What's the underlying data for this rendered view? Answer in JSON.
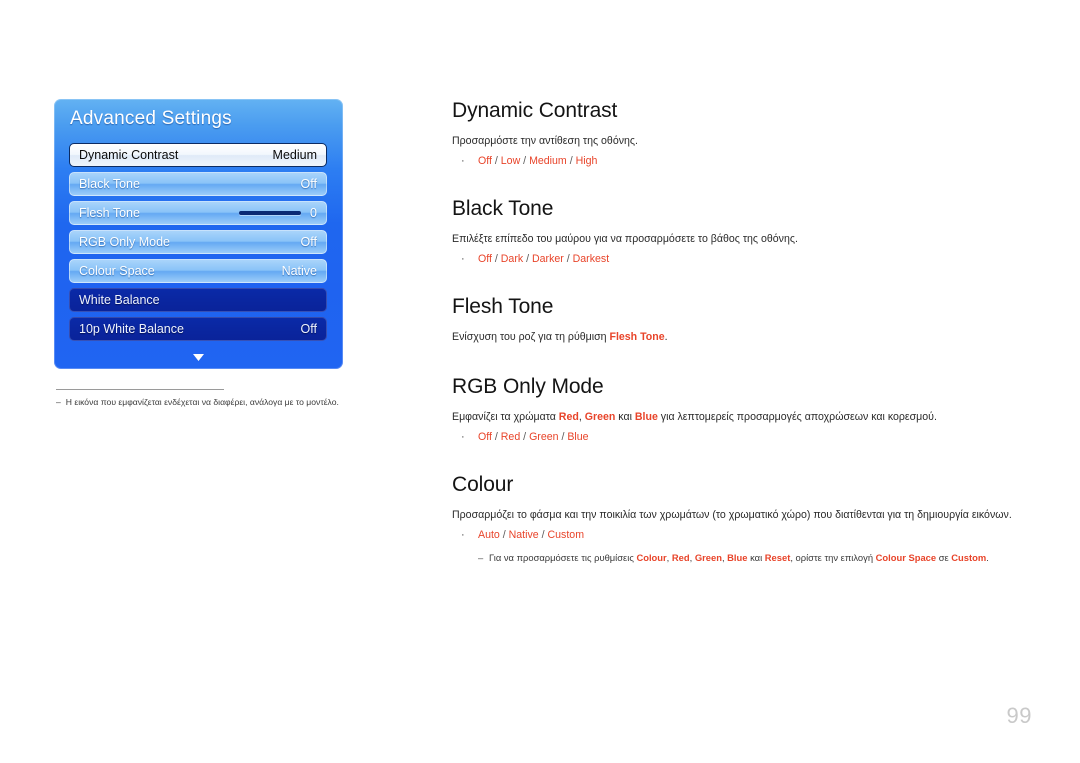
{
  "osd": {
    "title": "Advanced Settings",
    "scroll_arrow_icon": "chevron-down-icon",
    "rows": [
      {
        "label": "Dynamic Contrast",
        "value": "Medium",
        "style": "selected"
      },
      {
        "label": "Black Tone",
        "value": "Off",
        "style": "light"
      },
      {
        "label": "Flesh Tone",
        "value": "0",
        "style": "light",
        "slider": true
      },
      {
        "label": "RGB Only Mode",
        "value": "Off",
        "style": "light"
      },
      {
        "label": "Colour Space",
        "value": "Native",
        "style": "light"
      },
      {
        "label": "White Balance",
        "value": "",
        "style": "dark"
      },
      {
        "label": "10p White Balance",
        "value": "Off",
        "style": "dark"
      }
    ]
  },
  "figure_note": {
    "dash": "–",
    "text": "Η εικόνα που εμφανίζεται ενδέχεται να διαφέρει, ανάλογα με το μοντέλο."
  },
  "sections": {
    "dynamic_contrast": {
      "heading": "Dynamic Contrast",
      "body": "Προσαρμόστε την αντίθεση της οθόνης.",
      "bullet": "·",
      "options_1": "Off",
      "options_2": "Low",
      "options_3": "Medium",
      "options_4": "High"
    },
    "black_tone": {
      "heading": "Black Tone",
      "body": "Επιλέξτε επίπεδο του μαύρου για να προσαρμόσετε το βάθος της οθόνης.",
      "bullet": "·",
      "options_1": "Off",
      "options_2": "Dark",
      "options_3": "Darker",
      "options_4": "Darkest"
    },
    "flesh_tone": {
      "heading": "Flesh Tone",
      "body_pre": "Ενίσχυση του ροζ για τη ρύθμιση ",
      "body_accent": "Flesh Tone",
      "body_post": "."
    },
    "rgb_only_mode": {
      "heading": "RGB Only Mode",
      "body_pre": "Εμφανίζει τα χρώματα ",
      "body_red": "Red",
      "body_comma": ", ",
      "body_green": "Green",
      "body_mid": " και ",
      "body_blue": "Blue",
      "body_post": " για λεπτομερείς προσαρμογές αποχρώσεων και κορεσμού.",
      "bullet": "·",
      "options_1": "Off",
      "options_2": "Red",
      "options_3": "Green",
      "options_4": "Blue"
    },
    "colour": {
      "heading": "Colour",
      "body": "Προσαρμόζει το φάσμα και την ποικιλία των χρωμάτων (το χρωματικό χώρο) που διατίθενται για τη δημιουργία εικόνων.",
      "bullet": "·",
      "options_1": "Auto",
      "options_2": "Native",
      "options_3": "Custom",
      "note_dash": "–",
      "note_pre": "Για να προσαρμόσετε τις ρυθμίσεις ",
      "note_v1": "Colour",
      "note_v2": "Red",
      "note_v3": "Green",
      "note_v4": "Blue",
      "note_mid1": " και ",
      "note_v5": "Reset",
      "note_mid2": ", ορίστε την επιλογή ",
      "note_v6": "Colour Space",
      "note_mid3": " σε ",
      "note_v7": "Custom",
      "note_end": "."
    }
  },
  "page": {
    "number": "99"
  },
  "colors": {
    "accent_red": "#e8442a",
    "osd_blue": "#2065f2",
    "osd_row_dark": "#0a26a0",
    "page_number_gray": "#c9c9c9"
  }
}
